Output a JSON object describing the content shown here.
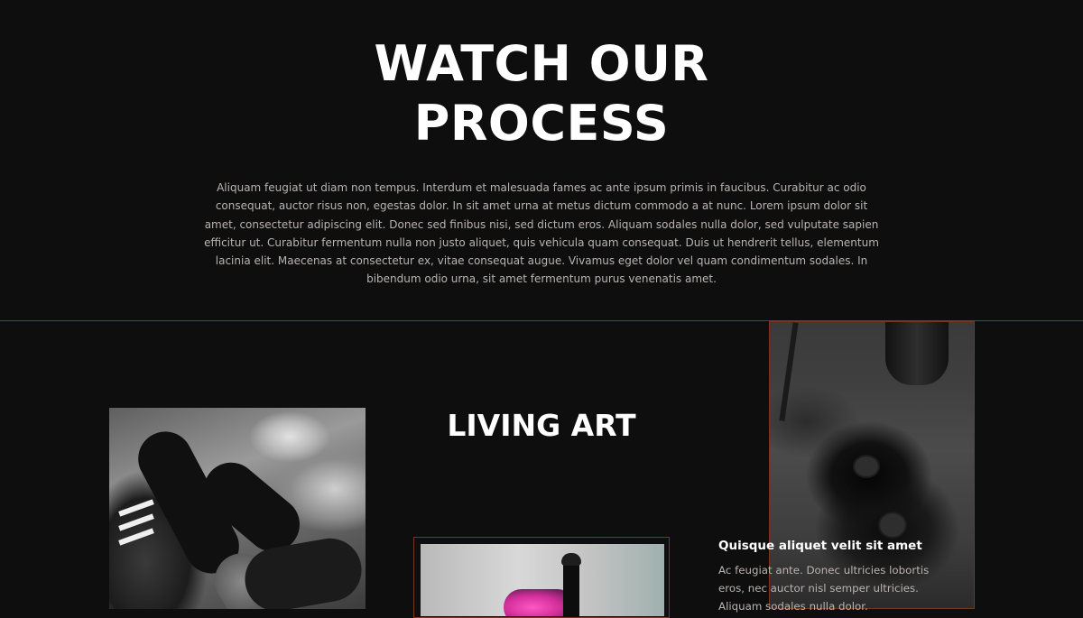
{
  "hero": {
    "title_line1": "WATCH OUR",
    "title_line2": "PROCESS",
    "description": "Aliquam feugiat ut diam non tempus. Interdum et malesuada fames ac ante ipsum primis in faucibus. Curabitur ac odio consequat, auctor risus non, egestas dolor. In sit amet urna at metus dictum commodo a at nunc. Lorem ipsum dolor sit amet, consectetur adipiscing elit. Donec sed finibus nisi, sed dictum eros. Aliquam sodales nulla dolor, sed vulputate sapien efficitur ut. Curabitur fermentum nulla non justo aliquet, quis vehicula quam consequat. Duis ut hendrerit tellus, elementum lacinia elit. Maecenas at consectetur ex, vitae consequat augue. Vivamus eget dolor vel quam condimentum sodales. In bibendum odio urna, sit amet fermentum purus venenatis amet."
  },
  "living_art": {
    "title": "LIVING ART"
  },
  "feature": {
    "heading": "Quisque aliquet velit sit amet",
    "text": "Ac feugiat ante. Donec ultricies lobortis eros, nec auctor nisl semper ultricies. Aliquam sodales nulla dolor."
  },
  "colors": {
    "background": "#0f0e0e",
    "accent_border": "#7a3520",
    "body_text": "#b9b4b1",
    "heading_text": "#ffffff"
  }
}
